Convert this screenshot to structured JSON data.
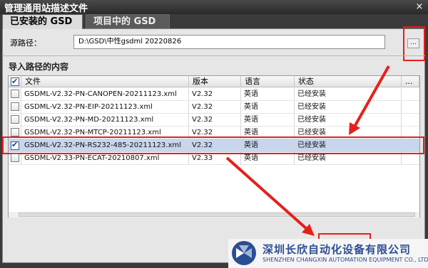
{
  "window": {
    "title": "管理通用站描述文件",
    "close": "×"
  },
  "tabs": [
    {
      "label": "已安装的 GSD"
    },
    {
      "label": "项目中的 GSD"
    }
  ],
  "source": {
    "label": "源路径：",
    "value": "D:\\GSD\\中性gsdml 20220826",
    "browse_label": "..."
  },
  "section": {
    "title": "导入路径的内容"
  },
  "table": {
    "headers": [
      "文件",
      "版本",
      "语言",
      "状态",
      "..."
    ],
    "rows": [
      {
        "file": "GSDML-V2.32-PN-CANOPEN-20211123.xml",
        "version": "V2.32",
        "language": "英语",
        "status": "已经安装",
        "checked": false
      },
      {
        "file": "GSDML-V2.32-PN-EIP-20211123.xml",
        "version": "V2.32",
        "language": "英语",
        "status": "已经安装",
        "checked": false
      },
      {
        "file": "GSDML-V2.32-PN-MD-20211123.xml",
        "version": "V2.32",
        "language": "英语",
        "status": "已经安装",
        "checked": false
      },
      {
        "file": "GSDML-V2.32-PN-MTCP-20211123.xml",
        "version": "V2.32",
        "language": "英语",
        "status": "已经安装",
        "checked": false
      },
      {
        "file": "GSDML-V2.32-PN-RS232-485-20211123.xml",
        "version": "V2.32",
        "language": "英语",
        "status": "已经安装",
        "checked": true
      },
      {
        "file": "GSDML-V2.33-PN-ECAT-20210807.xml",
        "version": "V2.33",
        "language": "英语",
        "status": "已经安装",
        "checked": false
      }
    ]
  },
  "watermark": {
    "company_cn": "深圳长欣自动化设备有限公司",
    "company_en": "SHENZHEN CHANGXIN AUTOMATION EQUIPMENT CO., LTD"
  },
  "colors": {
    "annotation": "#e4201b",
    "selected_row": "#c7d6ec",
    "brand": "#2b4d92"
  }
}
